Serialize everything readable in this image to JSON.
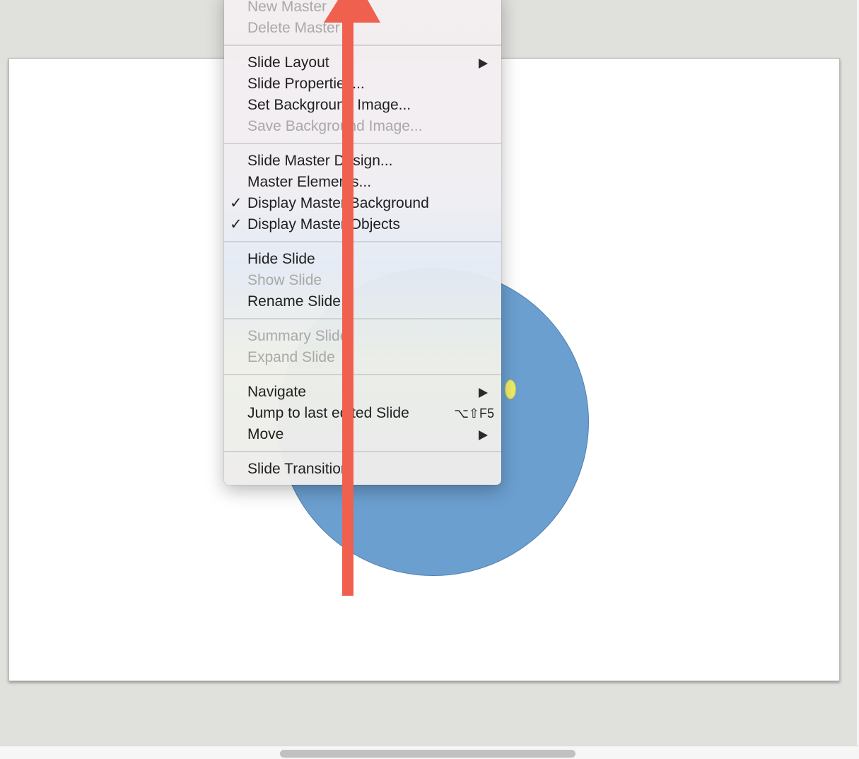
{
  "menu": {
    "items": [
      {
        "id": "new-master",
        "label": "New Master",
        "disabled": true
      },
      {
        "id": "delete-master",
        "label": "Delete Master",
        "disabled": true
      },
      {
        "id": "slide-layout",
        "label": "Slide Layout",
        "submenu": true
      },
      {
        "id": "slide-properties",
        "label": "Slide Properties..."
      },
      {
        "id": "set-background-image",
        "label": "Set Background Image..."
      },
      {
        "id": "save-background-image",
        "label": "Save Background Image...",
        "disabled": true
      },
      {
        "id": "slide-master-design",
        "label": "Slide Master Design..."
      },
      {
        "id": "master-elements",
        "label": "Master Elements..."
      },
      {
        "id": "display-master-background",
        "label": "Display Master Background",
        "checked": true
      },
      {
        "id": "display-master-objects",
        "label": "Display Master Objects",
        "checked": true
      },
      {
        "id": "hide-slide",
        "label": "Hide Slide"
      },
      {
        "id": "show-slide",
        "label": "Show Slide",
        "disabled": true
      },
      {
        "id": "rename-slide",
        "label": "Rename Slide"
      },
      {
        "id": "summary-slide",
        "label": "Summary Slide",
        "disabled": true
      },
      {
        "id": "expand-slide",
        "label": "Expand Slide",
        "disabled": true
      },
      {
        "id": "navigate",
        "label": "Navigate",
        "submenu": true
      },
      {
        "id": "jump-to-last-edited-slide",
        "label": "Jump to last edited Slide",
        "shortcut": "⌥⇧F5"
      },
      {
        "id": "move",
        "label": "Move",
        "submenu": true
      },
      {
        "id": "slide-transition",
        "label": "Slide Transition"
      }
    ],
    "check_mark": "✓"
  },
  "colors": {
    "arrow": "#f0604e",
    "circle_fill": "#6b9fd0",
    "handle_fill": "#f0ec6a"
  },
  "icons": {
    "submenu": "submenu-arrow-icon",
    "check": "checkmark-icon"
  }
}
